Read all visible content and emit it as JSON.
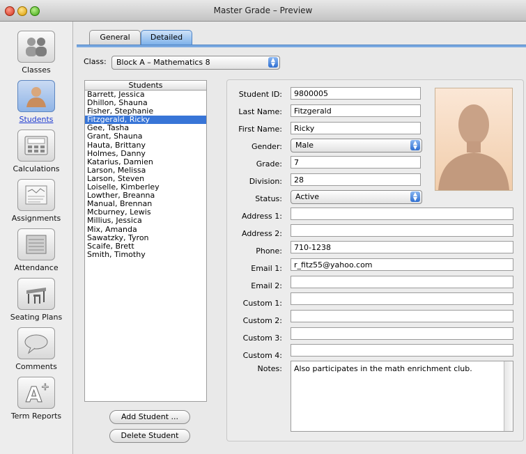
{
  "window": {
    "title": "Master Grade – Preview"
  },
  "sidebar": {
    "items": [
      {
        "label": "Classes",
        "icon": "people-icon"
      },
      {
        "label": "Students",
        "icon": "student-icon",
        "active": true
      },
      {
        "label": "Calculations",
        "icon": "calculator-icon"
      },
      {
        "label": "Assignments",
        "icon": "document-icon"
      },
      {
        "label": "Attendance",
        "icon": "attendance-icon"
      },
      {
        "label": "Seating Plans",
        "icon": "desk-icon"
      },
      {
        "label": "Comments",
        "icon": "speech-bubble-icon"
      },
      {
        "label": "Term Reports",
        "icon": "grade-a-plus-icon"
      }
    ]
  },
  "tabs": {
    "general": "General",
    "detailed": "Detailed",
    "selected": "Detailed"
  },
  "class_selector": {
    "label": "Class:",
    "value": "Block A – Mathematics 8"
  },
  "students": {
    "header": "Students",
    "selected": "Fitzgerald, Ricky",
    "list": [
      "Barrett, Jessica",
      "Dhillon, Shauna",
      "Fisher, Stephanie",
      "Fitzgerald, Ricky",
      "Gee, Tasha",
      "Grant, Shauna",
      "Hauta, Brittany",
      "Holmes, Danny",
      "Katarius, Damien",
      "Larson, Melissa",
      "Larson, Steven",
      "Loiselle, Kimberley",
      "Lowther, Breanna",
      "Manual, Brennan",
      "Mcburney, Lewis",
      "Millius, Jessica",
      "Mix, Amanda",
      "Sawatzky, Tyron",
      "Scaife, Brett",
      "Smith, Timothy"
    ],
    "add_button": "Add Student ...",
    "delete_button": "Delete Student"
  },
  "details": {
    "student_id": {
      "label": "Student ID:",
      "value": "9800005"
    },
    "last_name": {
      "label": "Last Name:",
      "value": "Fitzgerald"
    },
    "first_name": {
      "label": "First Name:",
      "value": "Ricky"
    },
    "gender": {
      "label": "Gender:",
      "value": "Male"
    },
    "grade": {
      "label": "Grade:",
      "value": "7"
    },
    "division": {
      "label": "Division:",
      "value": "28"
    },
    "status": {
      "label": "Status:",
      "value": "Active"
    },
    "address1": {
      "label": "Address 1:",
      "value": ""
    },
    "address2": {
      "label": "Address 2:",
      "value": ""
    },
    "phone": {
      "label": "Phone:",
      "value": "710-1238"
    },
    "email1": {
      "label": "Email 1:",
      "value": "r_fitz55@yahoo.com"
    },
    "email2": {
      "label": "Email 2:",
      "value": ""
    },
    "custom1": {
      "label": "Custom 1:",
      "value": ""
    },
    "custom2": {
      "label": "Custom 2:",
      "value": ""
    },
    "custom3": {
      "label": "Custom 3:",
      "value": ""
    },
    "custom4": {
      "label": "Custom 4:",
      "value": ""
    },
    "notes": {
      "label": "Notes:",
      "value": "Also participates in the math enrichment club."
    }
  },
  "colors": {
    "accent": "#3875d7",
    "tab_selected": "#7fb2ea",
    "link": "#1f3bd1"
  }
}
